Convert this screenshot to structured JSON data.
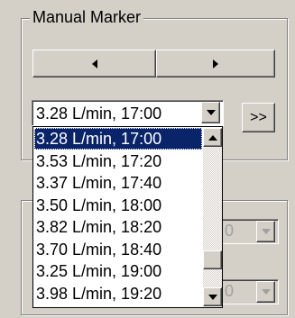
{
  "manual_marker": {
    "title": "Manual Marker",
    "prev_icon": "left-triangle-icon",
    "next_icon": "right-triangle-icon",
    "combo_value": "3.28 L/min, 17:00",
    "advance_label": ">>",
    "options": [
      "3.28 L/min, 17:00",
      "3.53 L/min, 17:20",
      "3.37 L/min, 17:40",
      "3.50 L/min, 18:00",
      "3.82 L/min, 18:20",
      "3.70 L/min, 18:40",
      "3.25 L/min, 19:00",
      "3.98 L/min, 19:20"
    ],
    "selected_index": 0,
    "scroll_fraction": 0.85
  },
  "lower_group": {
    "field1_text": "0",
    "field2_text": "0"
  },
  "colors": {
    "face": "#d4d0c8",
    "selection": "#0a246a",
    "disabled_text": "#a0a0a0"
  }
}
